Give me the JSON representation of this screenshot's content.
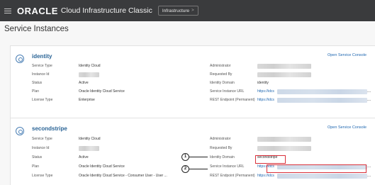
{
  "topbar": {
    "logo": "ORACLE",
    "product": "Cloud Infrastructure Classic",
    "crumb": "Infrastructure",
    "crumb_chevron": ">"
  },
  "page": {
    "title": "Service Instances"
  },
  "instances": [
    {
      "name": "identity",
      "open_console": "Open Service Console",
      "rows": [
        {
          "label": "Service Type",
          "value": "Identity Cloud",
          "label2": "Administrator",
          "value2": ""
        },
        {
          "label": "Instance Id",
          "value": "",
          "label2": "Requested By",
          "value2": ""
        },
        {
          "label": "Status",
          "value": "Active",
          "label2": "Identity Domain",
          "value2": "identity"
        },
        {
          "label": "Plan",
          "value": "Oracle Identity Cloud Service",
          "label2": "Service Instance URL",
          "value2": "https://idcs"
        },
        {
          "label": "License Type",
          "value": "Enterprise",
          "label2": "REST Endpoint (Permanent)",
          "value2": "https://idcs"
        }
      ]
    },
    {
      "name": "secondstripe",
      "open_console": "Open Service Console",
      "rows": [
        {
          "label": "Service Type",
          "value": "Identity Cloud",
          "label2": "Administrator",
          "value2": ""
        },
        {
          "label": "Instance Id",
          "value": "",
          "label2": "Requested By",
          "value2": ""
        },
        {
          "label": "Status",
          "value": "Active",
          "label2": "Identity Domain",
          "value2": "secondstripe"
        },
        {
          "label": "Plan",
          "value": "Oracle Identity Cloud Service",
          "label2": "Service Instance URL",
          "value2": "https://idcs"
        },
        {
          "label": "License Type",
          "value": "Oracle Identity Cloud Service - Consumer User - User ...",
          "label2": "REST Endpoint (Permanent)",
          "value2": "https://idcs"
        }
      ]
    }
  ],
  "callouts": [
    "1",
    "2"
  ],
  "ellipsis": "..."
}
